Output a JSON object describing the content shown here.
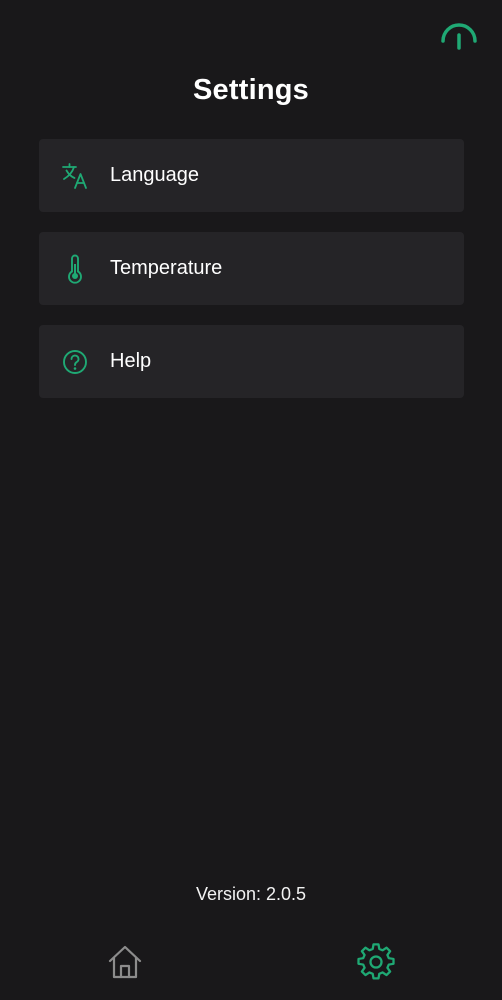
{
  "header": {
    "title": "Settings",
    "top_icon": "gauge-icon"
  },
  "settings": {
    "items": [
      {
        "label": "Language",
        "icon": "translate-icon"
      },
      {
        "label": "Temperature",
        "icon": "thermometer-icon"
      },
      {
        "label": "Help",
        "icon": "help-circle-icon"
      }
    ]
  },
  "footer": {
    "version": "Version: 2.0.5"
  },
  "nav": {
    "home_icon": "home-icon",
    "settings_icon": "gear-icon"
  },
  "colors": {
    "background": "#19181a",
    "card": "#252427",
    "accent": "#1fa974",
    "inactive_icon": "#8c8c8c",
    "text": "#ffffff"
  }
}
